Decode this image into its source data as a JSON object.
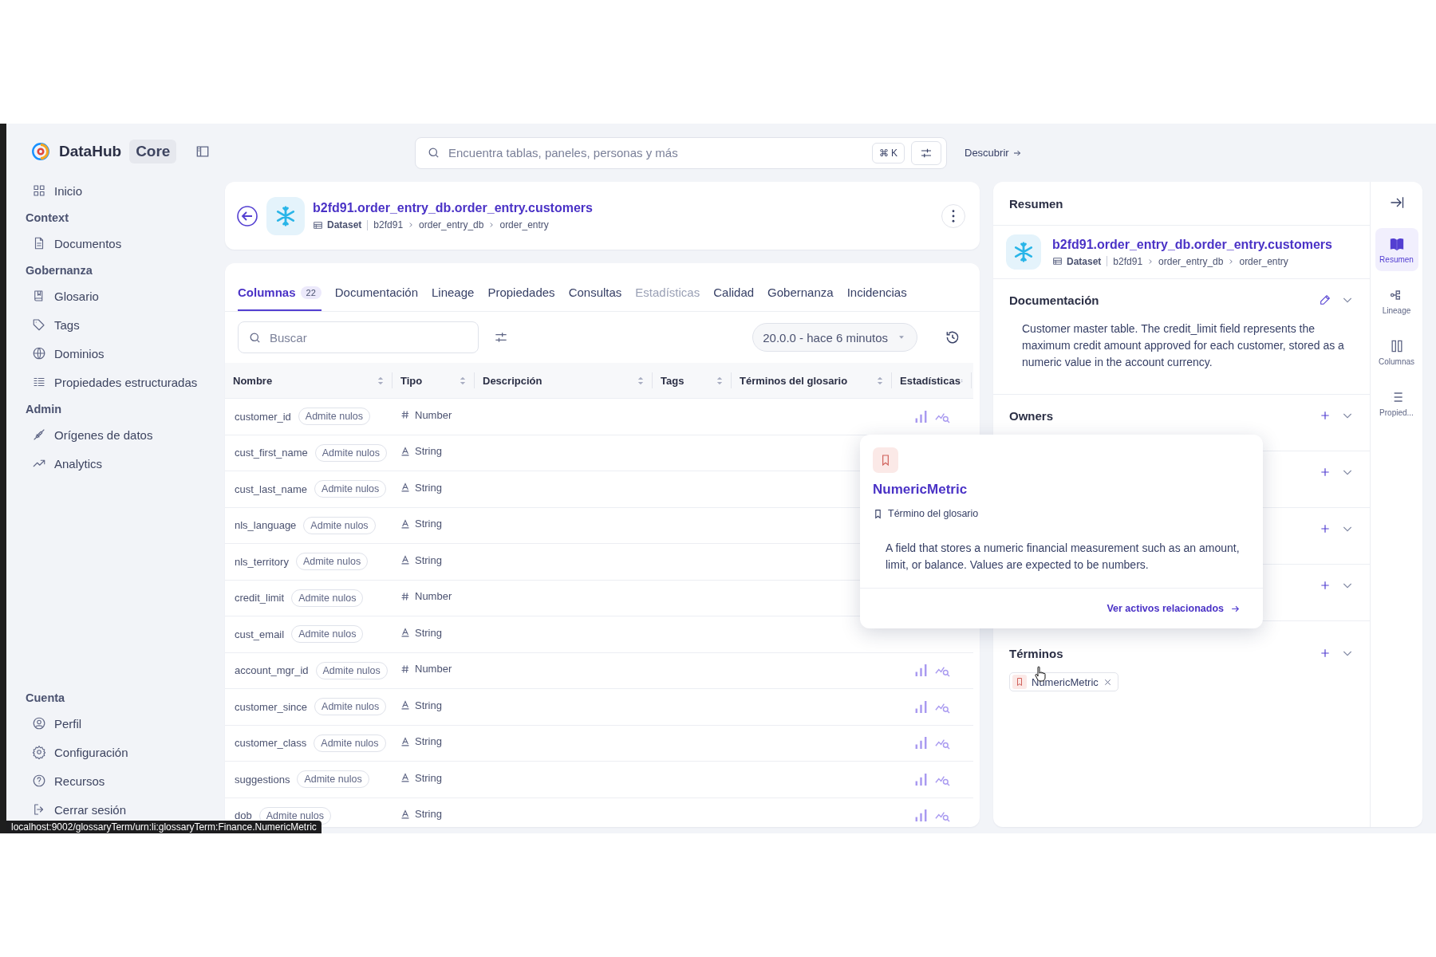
{
  "sidebar": {
    "brand": "DataHub",
    "edition": "Core",
    "sections": [
      {
        "items": [
          {
            "label": "Inicio"
          }
        ]
      },
      {
        "title": "Context",
        "items": [
          {
            "label": "Documentos"
          }
        ]
      },
      {
        "title": "Gobernanza",
        "items": [
          {
            "label": "Glosario"
          },
          {
            "label": "Tags"
          },
          {
            "label": "Dominios"
          },
          {
            "label": "Propiedades estructuradas"
          }
        ]
      },
      {
        "title": "Admin",
        "items": [
          {
            "label": "Orígenes de datos"
          },
          {
            "label": "Analytics"
          }
        ]
      }
    ],
    "account": {
      "title": "Cuenta",
      "items": [
        {
          "label": "Perfil"
        },
        {
          "label": "Configuración"
        },
        {
          "label": "Recursos"
        },
        {
          "label": "Cerrar sesión"
        }
      ]
    }
  },
  "search": {
    "placeholder": "Encuentra tablas, paneles, personas y más",
    "shortcut": "⌘ K",
    "discover": "Descubrir"
  },
  "entity": {
    "title": "b2fd91.order_entry_db.order_entry.customers",
    "type": "Dataset",
    "path": [
      "b2fd91",
      "order_entry_db",
      "order_entry"
    ]
  },
  "tabs": [
    {
      "label": "Columnas",
      "count": "22",
      "selected": true,
      "disabled": false
    },
    {
      "label": "Documentación",
      "selected": false,
      "disabled": false
    },
    {
      "label": "Lineage",
      "selected": false,
      "disabled": false
    },
    {
      "label": "Propiedades",
      "selected": false,
      "disabled": false
    },
    {
      "label": "Consultas",
      "selected": false,
      "disabled": false
    },
    {
      "label": "Estadísticas",
      "selected": false,
      "disabled": true
    },
    {
      "label": "Calidad",
      "selected": false,
      "disabled": false
    },
    {
      "label": "Gobernanza",
      "selected": false,
      "disabled": false
    },
    {
      "label": "Incidencias",
      "selected": false,
      "disabled": false
    }
  ],
  "toolbar": {
    "placeholder": "Buscar",
    "version": "20.0.0 - hace 6 minutos"
  },
  "table": {
    "columns": [
      "Nombre",
      "Tipo",
      "Descripción",
      "Tags",
      "Términos del glosario",
      "Estadísticas"
    ],
    "rows": [
      {
        "name": "customer_id",
        "badge": "Admite nulos",
        "kind": "number",
        "type": "Number",
        "stats": true
      },
      {
        "name": "cust_first_name",
        "badge": "Admite nulos",
        "kind": "string",
        "type": "String",
        "stats": false
      },
      {
        "name": "cust_last_name",
        "badge": "Admite nulos",
        "kind": "string",
        "type": "String",
        "stats": false
      },
      {
        "name": "nls_language",
        "badge": "Admite nulos",
        "kind": "string",
        "type": "String",
        "stats": false
      },
      {
        "name": "nls_territory",
        "badge": "Admite nulos",
        "kind": "string",
        "type": "String",
        "stats": false
      },
      {
        "name": "credit_limit",
        "badge": "Admite nulos",
        "kind": "number",
        "type": "Number",
        "stats": false
      },
      {
        "name": "cust_email",
        "badge": "Admite nulos",
        "kind": "string",
        "type": "String",
        "stats": false
      },
      {
        "name": "account_mgr_id",
        "badge": "Admite nulos",
        "kind": "number",
        "type": "Number",
        "stats": true
      },
      {
        "name": "customer_since",
        "badge": "Admite nulos",
        "kind": "string",
        "type": "String",
        "stats": true
      },
      {
        "name": "customer_class",
        "badge": "Admite nulos",
        "kind": "string",
        "type": "String",
        "stats": true
      },
      {
        "name": "suggestions",
        "badge": "Admite nulos",
        "kind": "string",
        "type": "String",
        "stats": true
      },
      {
        "name": "dob",
        "badge": "Admite nulos",
        "kind": "string",
        "type": "String",
        "stats": true
      }
    ]
  },
  "popover": {
    "title": "NumericMetric",
    "type": "Término del glosario",
    "description": "A field that stores a numeric financial measurement such as an amount, limit, or balance. Values are expected to be numbers.",
    "link": "Ver activos relacionados"
  },
  "summary": {
    "heading": "Resumen",
    "entity": {
      "title": "b2fd91.order_entry_db.order_entry.customers",
      "type": "Dataset",
      "path": [
        "b2fd91",
        "order_entry_db",
        "order_entry"
      ]
    },
    "documentation": {
      "title": "Documentación",
      "text": "Customer master table. The credit_limit field represents the maximum credit amount approved for each customer, stored as a numeric value in the account currency."
    },
    "sections": [
      {
        "kind": "open",
        "title": "Owners"
      },
      {
        "kind": "covered"
      },
      {
        "kind": "covered"
      },
      {
        "kind": "covered"
      },
      {
        "kind": "open",
        "title": "Términos",
        "chips": [
          "NumericMetric"
        ]
      }
    ]
  },
  "rail": [
    {
      "label": "Resumen",
      "selected": true
    },
    {
      "label": "Lineage",
      "selected": false
    },
    {
      "label": "Columnas",
      "selected": false
    },
    {
      "label": "Propied...",
      "selected": false
    }
  ],
  "status_url": "localhost:9002/glossaryTerm/urn:li:glossaryTerm:Finance.NumericMetric"
}
